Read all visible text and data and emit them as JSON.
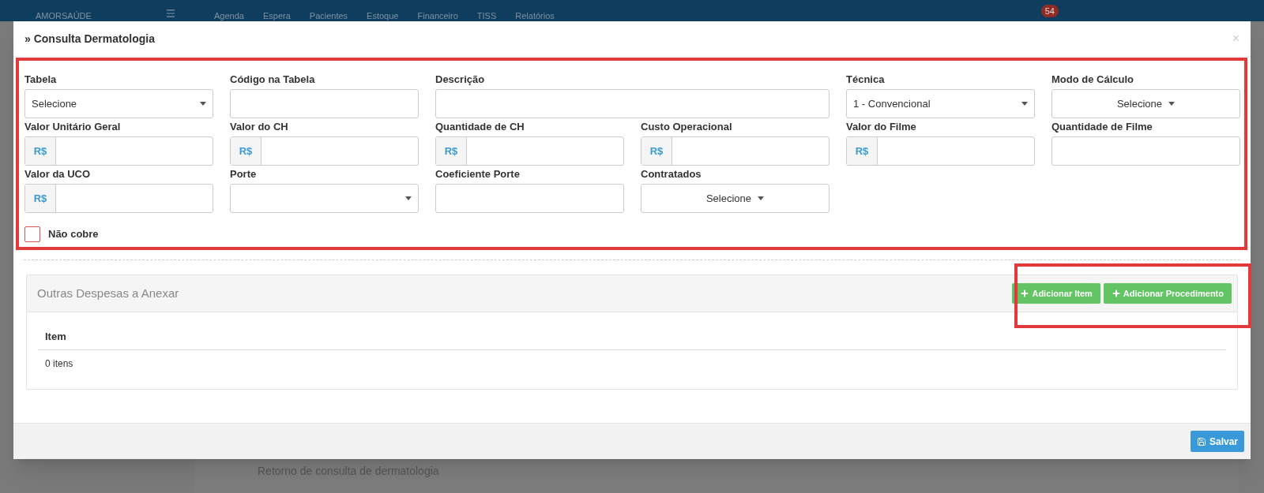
{
  "topbar": {
    "brand": "AMORSAÚDE",
    "nav": [
      "Agenda",
      "Espera",
      "Pacientes",
      "Estoque",
      "Financeiro",
      "TISS",
      "Relatórios"
    ],
    "badge": "54"
  },
  "modal": {
    "title": "» Consulta Dermatologia",
    "close": "×",
    "rows": [
      [
        {
          "label": "Tabela",
          "kind": "select",
          "value": "Selecione"
        },
        {
          "label": "Código na Tabela",
          "kind": "text"
        },
        {
          "label": "Descrição",
          "kind": "long-text"
        },
        "",
        {
          "label": "Técnica",
          "kind": "select",
          "value": "1 - Convencional"
        },
        {
          "label": "Modo de Cálculo",
          "kind": "multi",
          "value": "Selecione"
        }
      ],
      [
        {
          "label": "Valor Unitário Geral",
          "kind": "money",
          "prefix": "R$"
        },
        {
          "label": "Valor do CH",
          "kind": "money",
          "prefix": "R$"
        },
        {
          "label": "Quantidade de CH",
          "kind": "money",
          "prefix": "R$"
        },
        {
          "label": "Custo Operacional",
          "kind": "money",
          "prefix": "R$"
        },
        {
          "label": "Valor do Filme",
          "kind": "money",
          "prefix": "R$"
        },
        {
          "label": "Quantidade de Filme",
          "kind": "text"
        }
      ],
      [
        {
          "label": "Valor da UCO",
          "kind": "money",
          "prefix": "R$"
        },
        {
          "label": "Porte",
          "kind": "select"
        },
        {
          "label": "Coeficiente Porte",
          "kind": "text"
        },
        {
          "label": "Contratados",
          "kind": "multi",
          "value": "Selecione"
        }
      ]
    ],
    "checkbox": {
      "label": "Não cobre",
      "checked": false
    },
    "panel": {
      "title": "Outras Despesas a Anexar",
      "buttons": [
        "Adicionar Item",
        "Adicionar Procedimento"
      ],
      "column": "Item",
      "count": "0 itens"
    },
    "save": "Salvar"
  },
  "background_row": "Retorno de consulta de dermatologia"
}
